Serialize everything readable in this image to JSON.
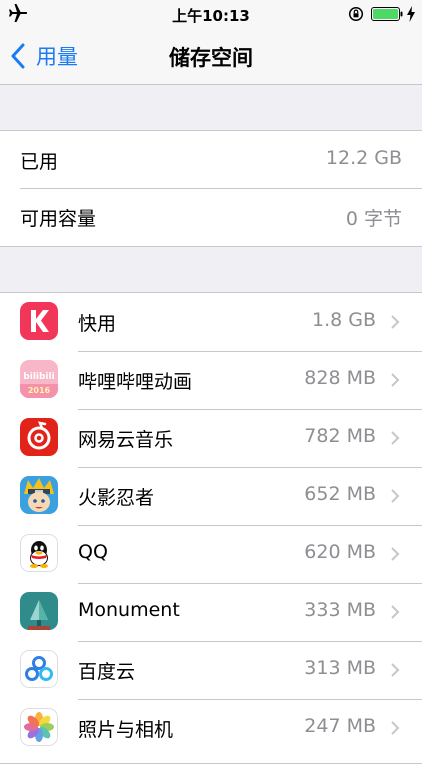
{
  "status_bar": {
    "time": "上午10:13"
  },
  "nav": {
    "back_label": "用量",
    "title": "储存空间"
  },
  "usage": [
    {
      "label": "已用",
      "value": "12.2 GB"
    },
    {
      "label": "可用容量",
      "value": "0 字节"
    }
  ],
  "apps": [
    {
      "name": "快用",
      "size": "1.8 GB",
      "icon": "kuaiyong-app-icon"
    },
    {
      "name": "哔哩哔哩动画",
      "size": "828 MB",
      "icon": "bilibili-app-icon"
    },
    {
      "name": "网易云音乐",
      "size": "782 MB",
      "icon": "netease-music-app-icon"
    },
    {
      "name": "火影忍者",
      "size": "652 MB",
      "icon": "naruto-app-icon"
    },
    {
      "name": "QQ",
      "size": "620 MB",
      "icon": "qq-app-icon"
    },
    {
      "name": "Monument",
      "size": "333 MB",
      "icon": "monument-app-icon"
    },
    {
      "name": "百度云",
      "size": "313 MB",
      "icon": "baidu-cloud-app-icon"
    },
    {
      "name": "照片与相机",
      "size": "247 MB",
      "icon": "photos-app-icon"
    }
  ],
  "colors": {
    "accent": "#1a7cf5",
    "secondary_text": "#8e8e93",
    "background": "#efeff4",
    "battery": "#4cd964"
  }
}
